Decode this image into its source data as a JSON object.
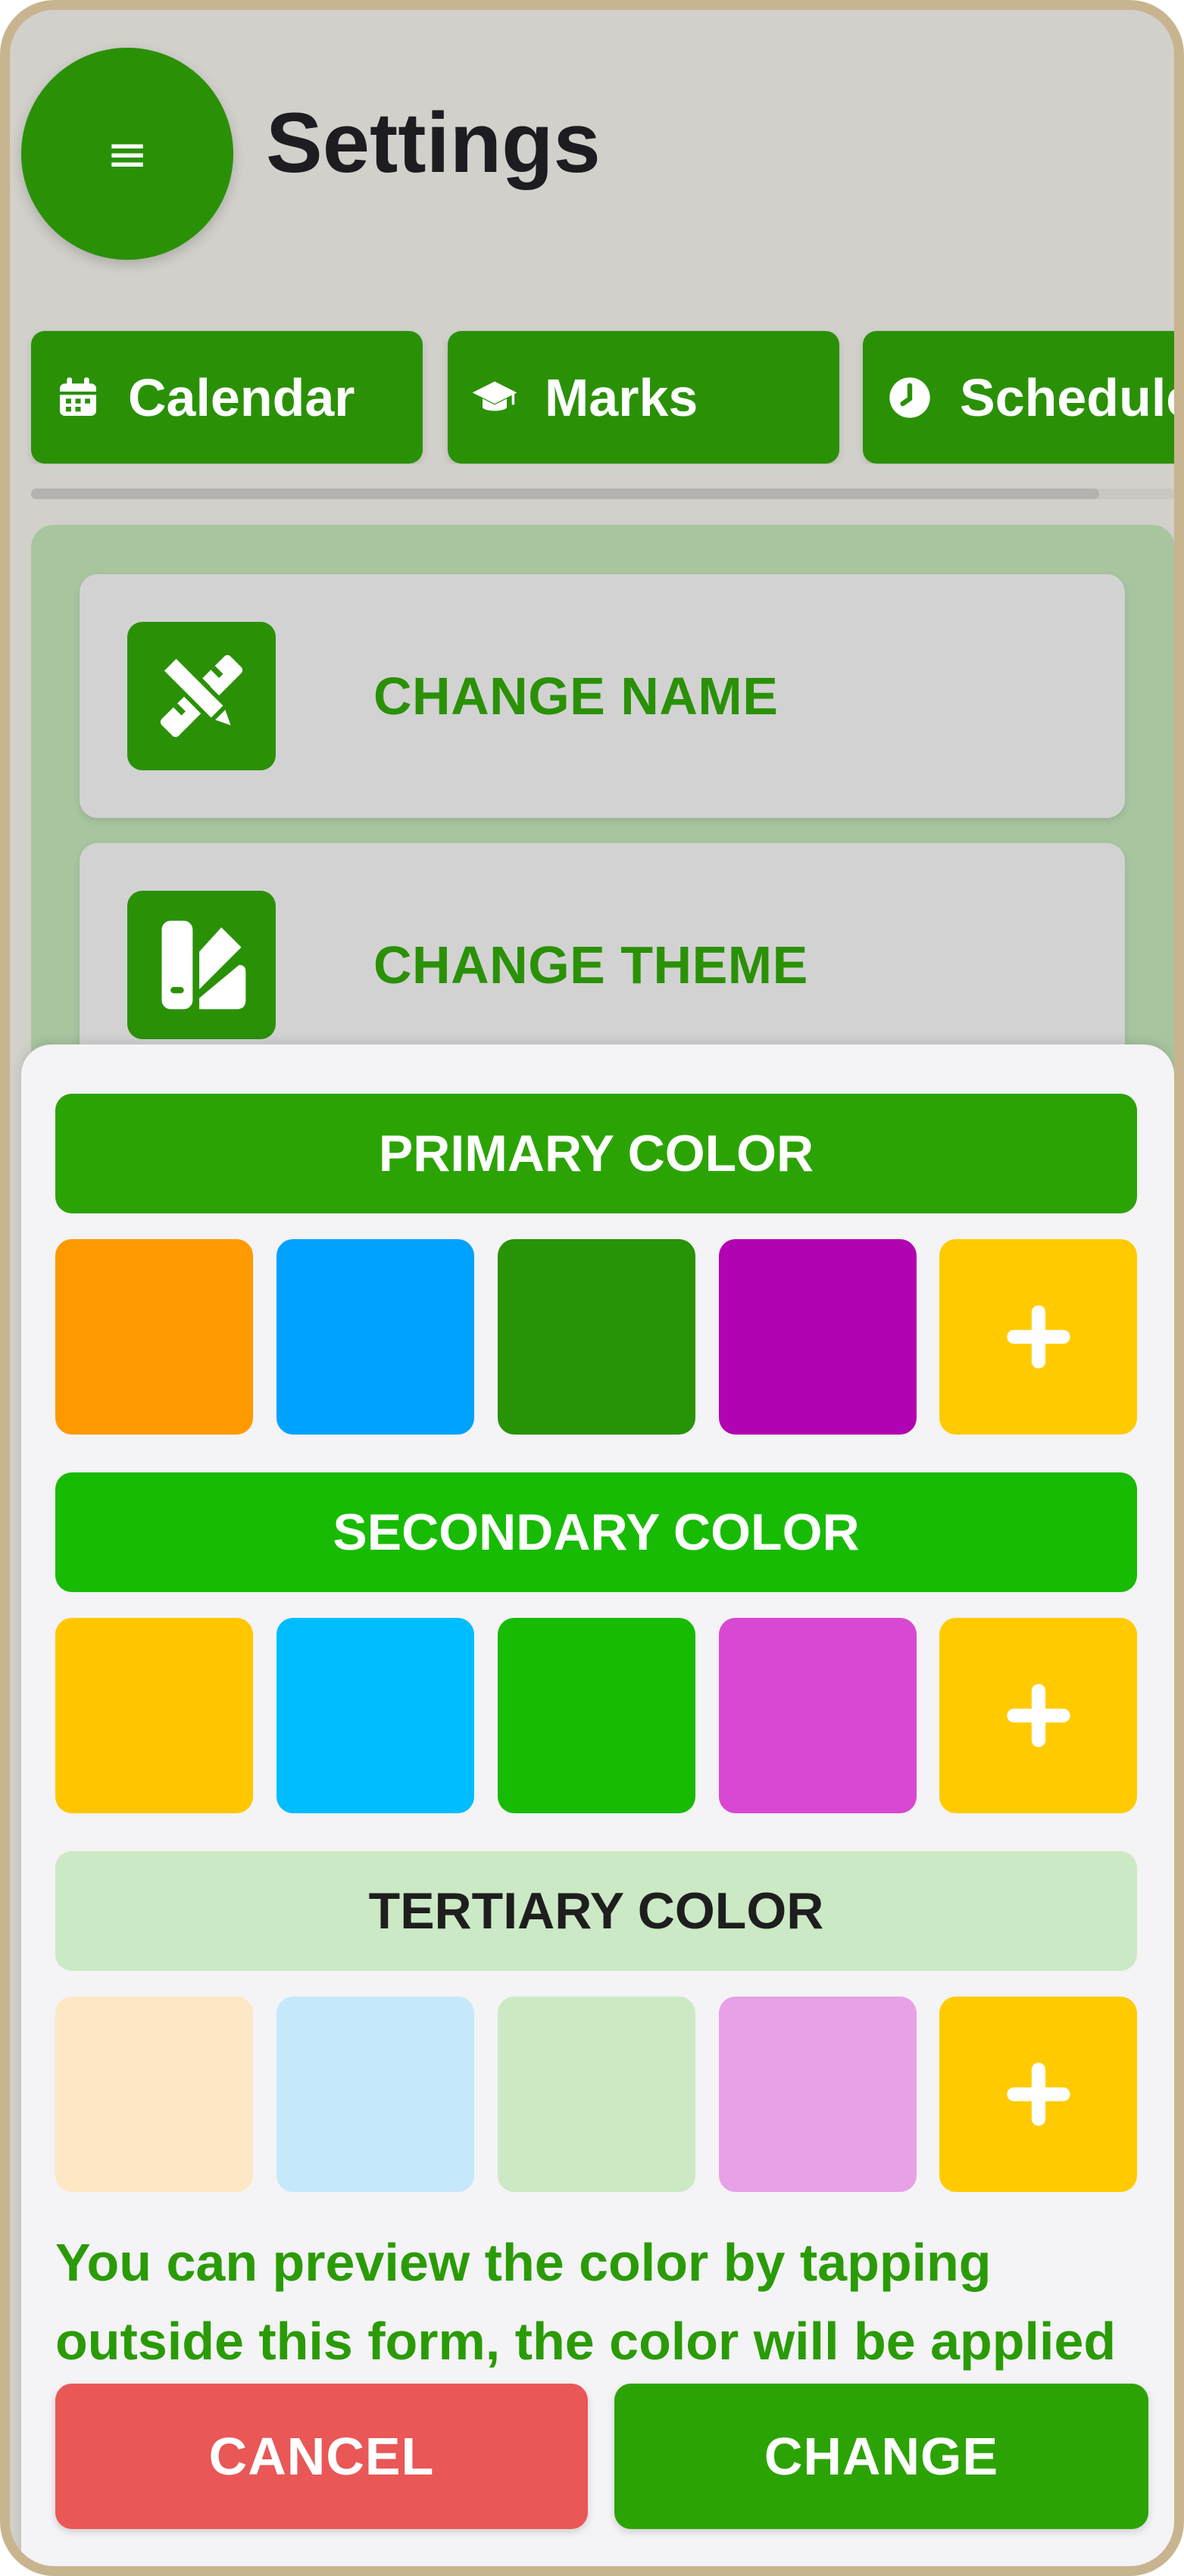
{
  "header": {
    "menu_glyph": "≡",
    "title": "Settings"
  },
  "tabs": [
    {
      "label": "Calendar",
      "icon": "calendar-icon"
    },
    {
      "label": "Marks",
      "icon": "graduation-cap-icon"
    },
    {
      "label": "Schedule",
      "icon": "clock-icon"
    }
  ],
  "settings": [
    {
      "label": "CHANGE NAME",
      "icon": "pencil-ruler-icon"
    },
    {
      "label": "CHANGE THEME",
      "icon": "palette-icon"
    }
  ],
  "theme_sheet": {
    "sections": [
      {
        "title": "PRIMARY COLOR",
        "swatches": [
          "#ff9900",
          "#00a2ff",
          "#289306",
          "#b203b2"
        ],
        "add_label": "+"
      },
      {
        "title": "SECONDARY COLOR",
        "swatches": [
          "#ffc600",
          "#00bdff",
          "#18bb03",
          "#d848d2"
        ],
        "add_label": "+"
      },
      {
        "title": "TERTIARY COLOR",
        "swatches": [
          "#fde7c5",
          "#c6e8fb",
          "#cce9c4",
          "#e8a0e6"
        ],
        "add_label": "+"
      }
    ],
    "add_swatch_color": "#ffcb00",
    "helper_text": "You can preview the color by tapping outside this form, the color will be applied",
    "cancel_label": "CANCEL",
    "change_label": "CHANGE"
  },
  "colors": {
    "brand_green": "#2a9107",
    "cancel_red": "#e95757"
  }
}
